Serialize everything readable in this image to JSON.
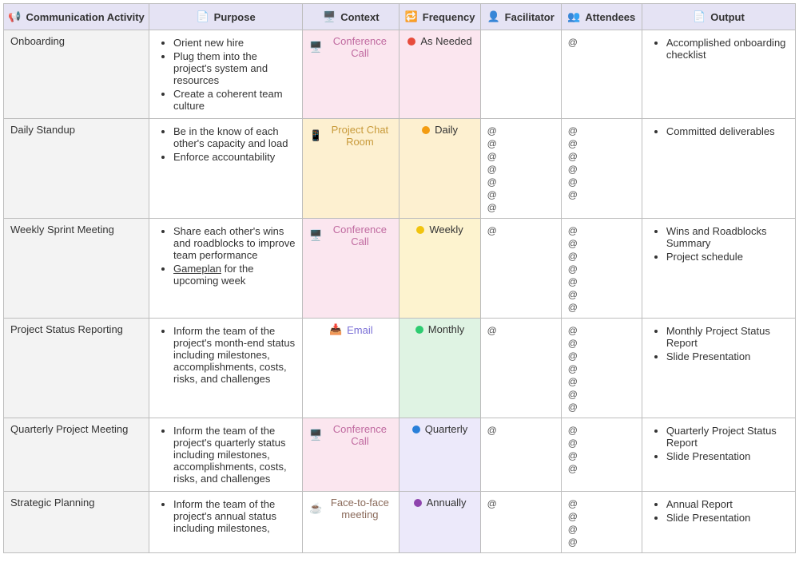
{
  "headers": {
    "activity": "Communication Activity",
    "purpose": "Purpose",
    "context": "Context",
    "frequency": "Frequency",
    "facilitator": "Facilitator",
    "attendees": "Attendees",
    "output": "Output"
  },
  "context_labels": {
    "conference_call": "Conference Call",
    "project_chat_room": "Project Chat Room",
    "email": "Email",
    "face_to_face": "Face-to-face meeting"
  },
  "frequency_labels": {
    "as_needed": "As Needed",
    "daily": "Daily",
    "weekly": "Weekly",
    "monthly": "Monthly",
    "quarterly": "Quarterly",
    "annually": "Annually"
  },
  "rows": [
    {
      "activity": "Onboarding",
      "purpose": [
        "Orient new hire",
        "Plug them into the project's system and resources",
        "Create a coherent team culture"
      ],
      "context": "conference_call",
      "context_bg": "bg-pink",
      "frequency": "as_needed",
      "freq_dot": "dot-red",
      "freq_bg": "bg-pink",
      "facilitator_count": 0,
      "attendees_count": 1,
      "output": [
        "Accomplished onboarding checklist"
      ]
    },
    {
      "activity": "Daily Standup",
      "purpose": [
        "Be in the know of each other's capacity and load",
        "Enforce accountability"
      ],
      "context": "project_chat_room",
      "context_bg": "bg-amber",
      "frequency": "daily",
      "freq_dot": "dot-orange",
      "freq_bg": "bg-amber",
      "facilitator_count": 7,
      "attendees_count": 6,
      "output": [
        "Committed deliverables"
      ]
    },
    {
      "activity": "Weekly Sprint Meeting",
      "purpose": [
        "Share each other's wins and roadblocks to improve team performance",
        "<u>Gameplan</u> for the upcoming week"
      ],
      "context": "conference_call",
      "context_bg": "bg-pink",
      "frequency": "weekly",
      "freq_dot": "dot-yellow",
      "freq_bg": "bg-yellow",
      "facilitator_count": 1,
      "attendees_count": 7,
      "output": [
        "Wins and Roadblocks Summary",
        "Project schedule"
      ]
    },
    {
      "activity": "Project Status Reporting",
      "purpose": [
        "Inform the team of the project's month-end status including milestones, accomplishments, costs, risks, and challenges"
      ],
      "context": "email",
      "context_bg": "",
      "frequency": "monthly",
      "freq_dot": "dot-green",
      "freq_bg": "bg-green",
      "facilitator_count": 1,
      "attendees_count": 7,
      "output": [
        "Monthly Project Status Report",
        "Slide Presentation"
      ]
    },
    {
      "activity": "Quarterly Project Meeting",
      "purpose": [
        "Inform the team of the project's quarterly status including milestones, accomplishments, costs, risks, and challenges"
      ],
      "context": "conference_call",
      "context_bg": "bg-pink",
      "frequency": "quarterly",
      "freq_dot": "dot-blue",
      "freq_bg": "bg-lilac",
      "facilitator_count": 1,
      "attendees_count": 4,
      "output": [
        "Quarterly Project Status Report",
        "Slide Presentation"
      ]
    },
    {
      "activity": "Strategic Planning",
      "purpose": [
        "Inform the team of the project's annual status including milestones,"
      ],
      "context": "face_to_face",
      "context_bg": "",
      "frequency": "annually",
      "freq_dot": "dot-purple",
      "freq_bg": "bg-lilac",
      "facilitator_count": 1,
      "attendees_count": 4,
      "output": [
        "Annual Report",
        "Slide Presentation"
      ]
    }
  ]
}
